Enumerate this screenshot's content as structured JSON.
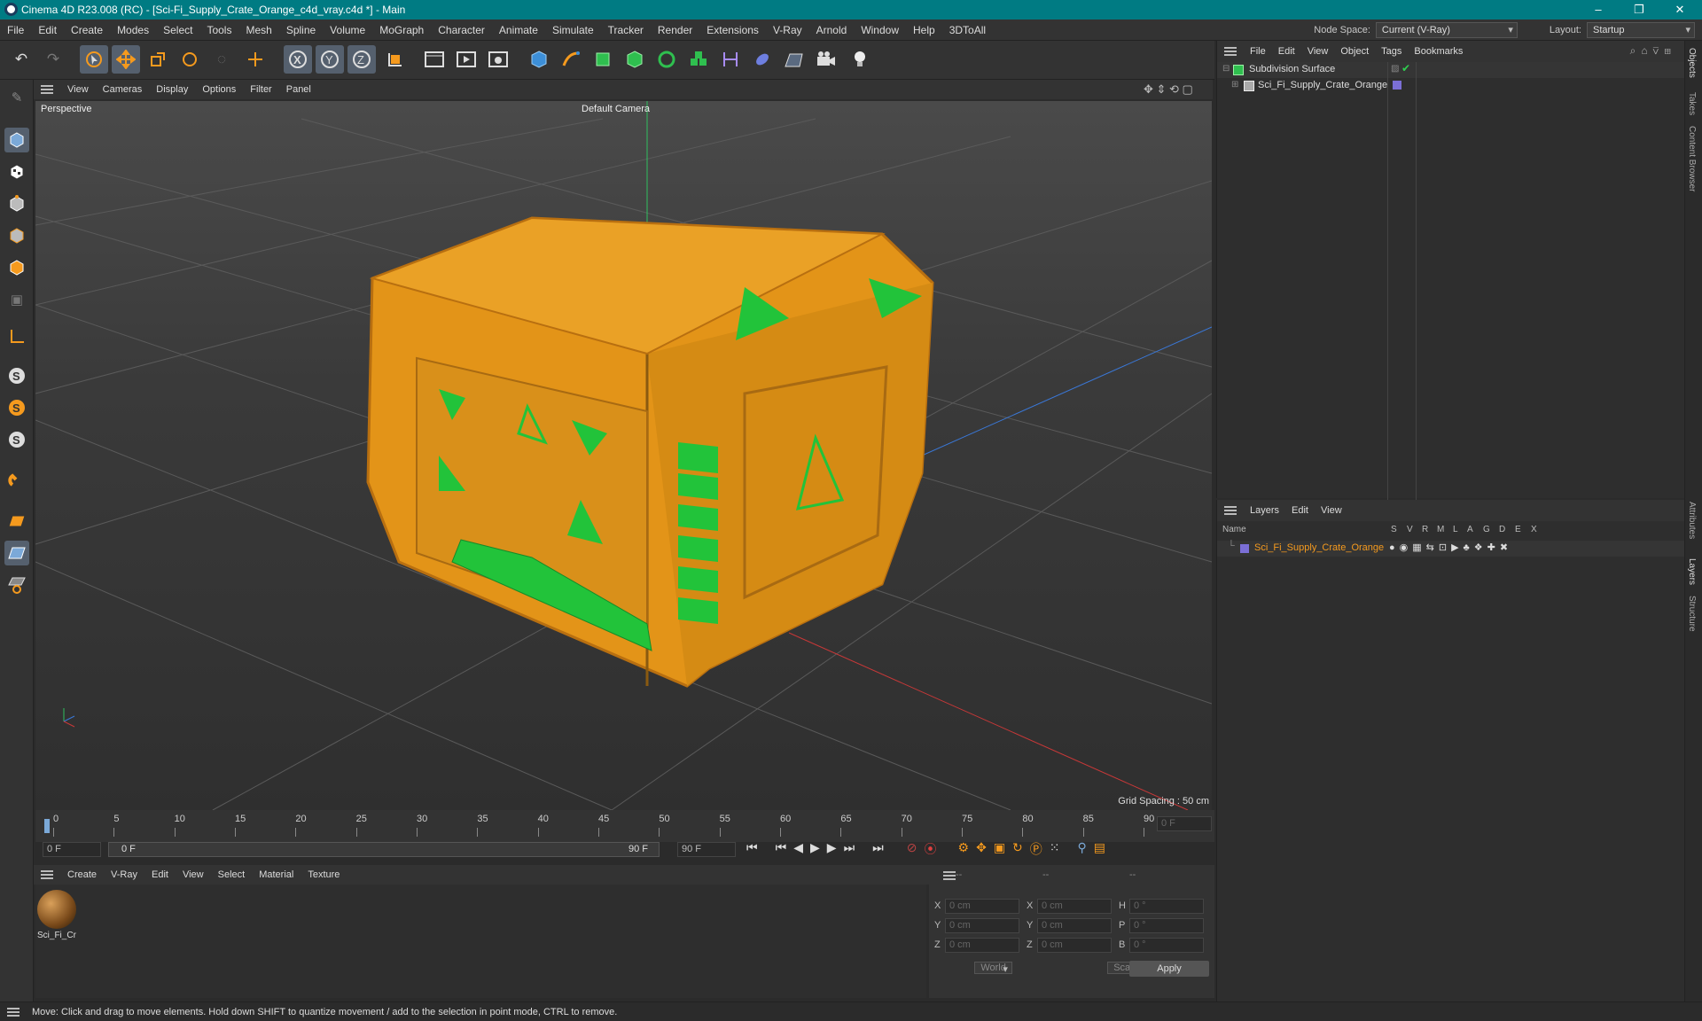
{
  "titlebar": {
    "title": "Cinema 4D R23.008 (RC) - [Sci-Fi_Supply_Crate_Orange_c4d_vray.c4d *] - Main",
    "minimize": "–",
    "restore": "❐",
    "close": "✕"
  },
  "menu": [
    "File",
    "Edit",
    "Create",
    "Modes",
    "Select",
    "Tools",
    "Mesh",
    "Spline",
    "Volume",
    "MoGraph",
    "Character",
    "Animate",
    "Simulate",
    "Tracker",
    "Render",
    "Extensions",
    "V-Ray",
    "Arnold",
    "Window",
    "Help",
    "3DToAll"
  ],
  "nodespace": {
    "label": "Node Space:",
    "value": "Current (V-Ray)"
  },
  "layout": {
    "label": "Layout:",
    "value": "Startup"
  },
  "viewport_menu": [
    "View",
    "Cameras",
    "Display",
    "Options",
    "Filter",
    "Panel"
  ],
  "viewport": {
    "name": "Perspective",
    "camera": "Default Camera",
    "grid_spacing": "Grid Spacing : 50 cm"
  },
  "timeline": {
    "ticks": [
      "0",
      "5",
      "10",
      "15",
      "20",
      "25",
      "30",
      "35",
      "40",
      "45",
      "50",
      "55",
      "60",
      "65",
      "70",
      "75",
      "80",
      "85",
      "90"
    ],
    "frame_field": "0 F",
    "start": "0 F",
    "range_start": "0 F",
    "range_end": "90 F",
    "end": "90 F",
    "current": "0 F"
  },
  "material_menu": [
    "Create",
    "V-Ray",
    "Edit",
    "View",
    "Select",
    "Material",
    "Texture"
  ],
  "material": {
    "name": "Sci_Fi_Cr"
  },
  "attributes": {
    "headers": [
      "--",
      "--",
      "--"
    ],
    "rows": [
      {
        "a": "X",
        "av": "0 cm",
        "b": "X",
        "bv": "0 cm",
        "c": "H",
        "cv": "0 °"
      },
      {
        "a": "Y",
        "av": "0 cm",
        "b": "Y",
        "bv": "0 cm",
        "c": "P",
        "cv": "0 °"
      },
      {
        "a": "Z",
        "av": "0 cm",
        "b": "Z",
        "bv": "0 cm",
        "c": "B",
        "cv": "0 °"
      }
    ],
    "coord": "World",
    "mode": "Scale",
    "apply": "Apply"
  },
  "objects_menu": [
    "File",
    "Edit",
    "View",
    "Object",
    "Tags",
    "Bookmarks"
  ],
  "objects": [
    {
      "name": "Subdivision Surface"
    },
    {
      "name": "Sci_Fi_Supply_Crate_Orange"
    }
  ],
  "layers_menu": [
    "Layers",
    "Edit",
    "View"
  ],
  "layers": {
    "headers": [
      "Name",
      "S",
      "V",
      "R",
      "M",
      "L",
      "A",
      "G",
      "D",
      "E",
      "X"
    ],
    "rows": [
      {
        "name": "Sci_Fi_Supply_Crate_Orange"
      }
    ]
  },
  "side_tabs": [
    "Objects",
    "Takes",
    "Content Browser",
    "Attributes",
    "Layers",
    "Structure"
  ],
  "status": "Move: Click and drag to move elements. Hold down SHIFT to quantize movement / add to the selection in point mode, CTRL to remove.",
  "colors": {
    "titlebar": "#007b83",
    "accent": "#f59a1e",
    "layer": "#7b6fd6"
  }
}
